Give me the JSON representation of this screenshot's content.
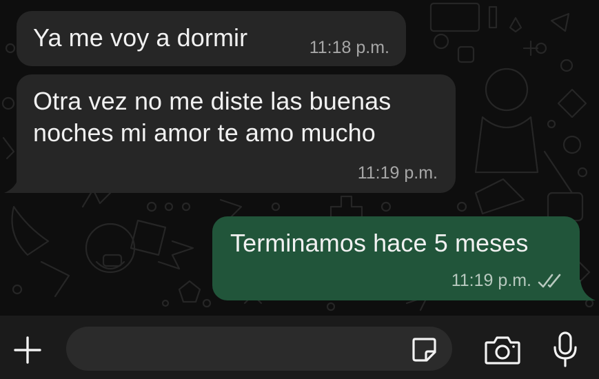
{
  "messages": [
    {
      "direction": "incoming",
      "text": "Ya me voy a dormir",
      "time": "11:18 p.m."
    },
    {
      "direction": "incoming",
      "text": "Otra vez no me diste las buenas\nnoches mi amor te amo mucho",
      "time": "11:19 p.m."
    },
    {
      "direction": "outgoing",
      "text": "Terminamos hace 5 meses",
      "time": "11:19 p.m.",
      "status": "read"
    }
  ],
  "input_bar": {
    "placeholder": "",
    "icons": [
      "plus-icon",
      "sticker-icon",
      "camera-icon",
      "microphone-icon"
    ]
  },
  "colors": {
    "incoming_bubble": "#262626",
    "outgoing_bubble": "#21553a",
    "background": "#0e0e0e",
    "input_bar": "#1b1b1b"
  }
}
